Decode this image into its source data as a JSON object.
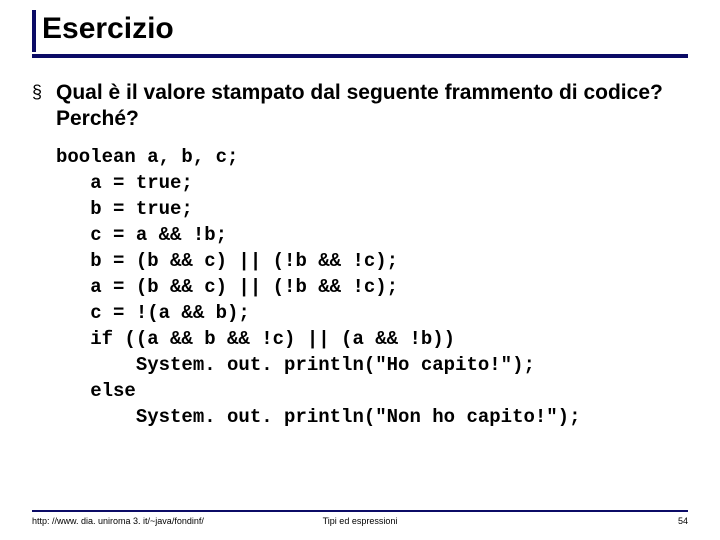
{
  "title": "Esercizio",
  "bullet_glyph": "§",
  "question": "Qual è il valore stampato dal seguente frammento di codice? Perché?",
  "code_lines": [
    "boolean a, b, c;",
    "   a = true;",
    "   b = true;",
    "   c = a && !b;",
    "   b = (b && c) || (!b && !c);",
    "   a = (b && c) || (!b && !c);",
    "   c = !(a && b);",
    "   if ((a && b && !c) || (a && !b))",
    "       System. out. println(\"Ho capito!\");",
    "   else",
    "       System. out. println(\"Non ho capito!\");"
  ],
  "footer": {
    "left": "http: //www. dia. uniroma 3. it/~java/fondinf/",
    "center": "Tipi ed espressioni",
    "page": "54"
  }
}
